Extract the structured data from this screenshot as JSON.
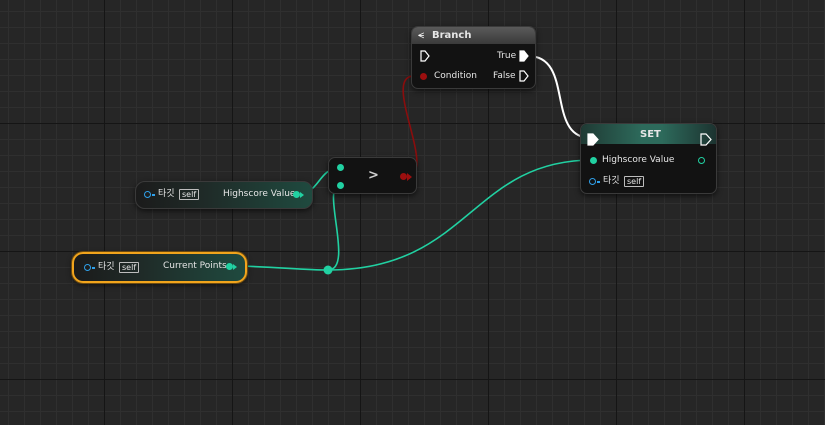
{
  "colors": {
    "float_pin": "#21d1a2",
    "bool_pin": "#9c0f0f",
    "object_pin": "#2fa0ea",
    "selection": "#f1a41c",
    "exec_wire": "#ffffff"
  },
  "branch": {
    "title": "Branch",
    "icon": "branch-icon",
    "condition_label": "Condition",
    "true_label": "True",
    "false_label": "False"
  },
  "set": {
    "title": "SET",
    "value_label": "Highscore Value",
    "target_label": "타깃",
    "target_value": "self"
  },
  "compare": {
    "operator": ">"
  },
  "highscore_getter": {
    "target_label": "타깃",
    "target_value": "self",
    "value_label": "Highscore Value"
  },
  "points_getter": {
    "target_label": "타깃",
    "target_value": "self",
    "value_label": "Current Points"
  }
}
